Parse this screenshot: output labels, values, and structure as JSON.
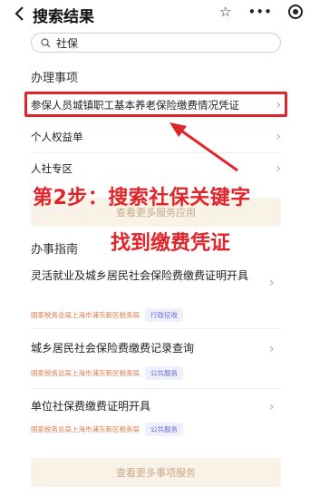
{
  "header": {
    "title": "搜索结果",
    "icons": [
      "back-icon",
      "star-icon",
      "more-icon",
      "target-icon"
    ]
  },
  "search": {
    "value": "社保"
  },
  "section1": {
    "title": "办理事项",
    "items": [
      {
        "label": "参保人员城镇职工基本养老保险缴费情况凭证"
      },
      {
        "label": "个人权益单"
      },
      {
        "label": "人社专区"
      }
    ],
    "more": "查看更多服务应用"
  },
  "annotation": {
    "step": "第2步：搜索社保关键字",
    "result": "找到缴费凭证"
  },
  "section2": {
    "title": "办事指南",
    "items": [
      {
        "title": "灵活就业及城乡居民社会保险费缴费证明开具",
        "source": "国家税务总局上海市浦东新区税务局",
        "tag": "行政征收"
      },
      {
        "title": "城乡居民社会保险费缴费记录查询",
        "source": "国家税务总局上海市浦东新区税务局",
        "tag": "公共服务"
      },
      {
        "title": "单位社保费缴费证明开具",
        "source": "国家税务总局上海市浦东新区税务局",
        "tag": "公共服务"
      }
    ],
    "more": "查看更多事项服务"
  },
  "colors": {
    "highlight": "#e0242a",
    "tag_text": "#6b6bd6",
    "source_text": "#e07a4a",
    "more_bg": "#f8f2e7"
  }
}
